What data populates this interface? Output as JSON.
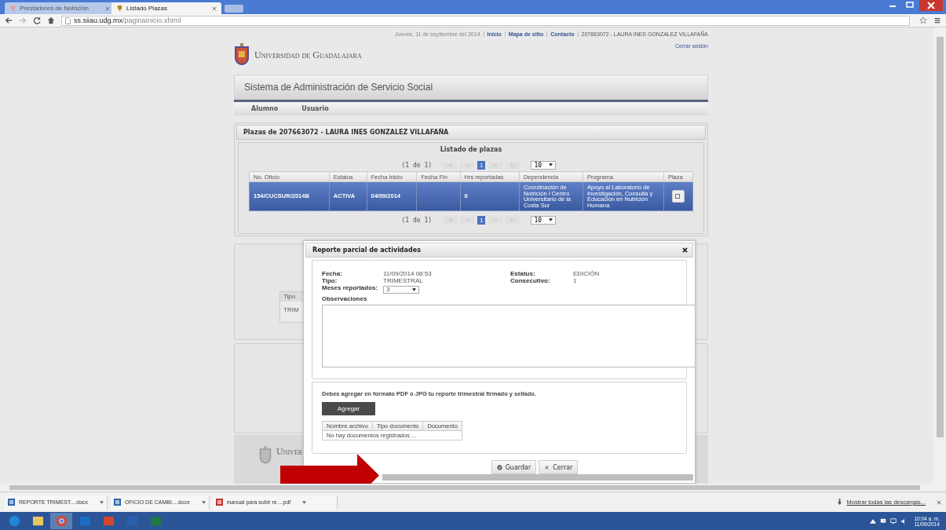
{
  "browser": {
    "tabs": [
      {
        "title": "Prestadores de Nutrición",
        "selected": false
      },
      {
        "title": "Listado Plazas",
        "selected": true
      }
    ],
    "url_host": "ss.siiau.udg.mx",
    "url_path": "/paginaInicio.xhtml"
  },
  "header": {
    "university": "Universidad de Guadalajara",
    "date": "Jueves, 11 de septiembre del 2014",
    "links": [
      "Inicio",
      "Mapa de sitio",
      "Contacto"
    ],
    "user": "207663072 - LAURA INES GONZALEZ VILLAFAÑA",
    "logout": "Cerrar sesión"
  },
  "app_title": "Sistema de Administración de Servicio Social",
  "menu": [
    "Alumno",
    "Usuario"
  ],
  "panel_title": "Plazas de 207663072 - LAURA INES GONZALEZ VILLAFAÑA",
  "listado": {
    "title": "Listado de plazas",
    "pagers": [
      {
        "page_report": "(1 de 1)",
        "pages": [
          {
            "label": "1",
            "selected": true
          }
        ],
        "rows_per_page": "10"
      },
      {
        "page_report": "(1 de 1)",
        "pages": [
          {
            "label": "1",
            "selected": true
          }
        ],
        "rows_per_page": "10"
      }
    ],
    "columns": [
      "No. Oficio",
      "Estatus",
      "Fecha Inicio",
      "Fecha Fin",
      "Hrs reportadas",
      "Dependencia",
      "Programa",
      "Plaza"
    ],
    "rows": [
      {
        "selected": true,
        "cells": [
          "154/CUCSUR/2014B",
          "ACTIVA",
          "04/09/2014",
          "",
          "0",
          "Coordinación de Nutrición / Centro Universitario de la Costa Sur",
          "Apoyo al Laboratorio de Investigación, Consulta y Educación en Nutrición Humana"
        ]
      }
    ]
  },
  "background_table": {
    "column": "Tipo",
    "cell": "TRIM"
  },
  "footer": {
    "university": "Univer"
  },
  "dialog": {
    "title": "Reporte parcial de actividades",
    "left_fields": [
      {
        "label": "Fecha:",
        "value": "11/09/2014 08:53"
      },
      {
        "label": "Tipo:",
        "value": "TRIMESTRAL"
      }
    ],
    "right_fields": [
      {
        "label": "Estatus:",
        "value": "EDICIÓN"
      },
      {
        "label": "Consecutivo:",
        "value": "1"
      }
    ],
    "months_label": "Meses reportados:",
    "months_value": "3",
    "observations_label": "Observaciones",
    "note": "Debes agregar en formato PDF o JPG tu reporte trimestral firmado y sellado.",
    "add_button": "Agregar",
    "doc_columns": [
      "Nombre archivo",
      "Tipo documento",
      "Documento"
    ],
    "empty_message": "No hay documentos registrados ...",
    "save_button": "Guardar",
    "close_button": "Cerrar"
  },
  "downloads": [
    {
      "name": "REPORTE TRIMEST....docx",
      "kind": "word"
    },
    {
      "name": "OFICIO DE CAMBI....docx",
      "kind": "word"
    },
    {
      "name": "manual para subir re....pdf",
      "kind": "pdf"
    }
  ],
  "show_all_downloads": "Mostrar todas las descargas...",
  "taskbar": [
    {
      "kind": "ie",
      "active": false
    },
    {
      "kind": "folder",
      "active": false
    },
    {
      "kind": "chrome",
      "active": true
    },
    {
      "kind": "outlook",
      "active": false
    },
    {
      "kind": "powerpoint",
      "active": false
    },
    {
      "kind": "word",
      "active": false
    },
    {
      "kind": "excel",
      "active": false
    }
  ],
  "clock": {
    "time": "10:04 a. m.",
    "date": "11/09/2014"
  }
}
